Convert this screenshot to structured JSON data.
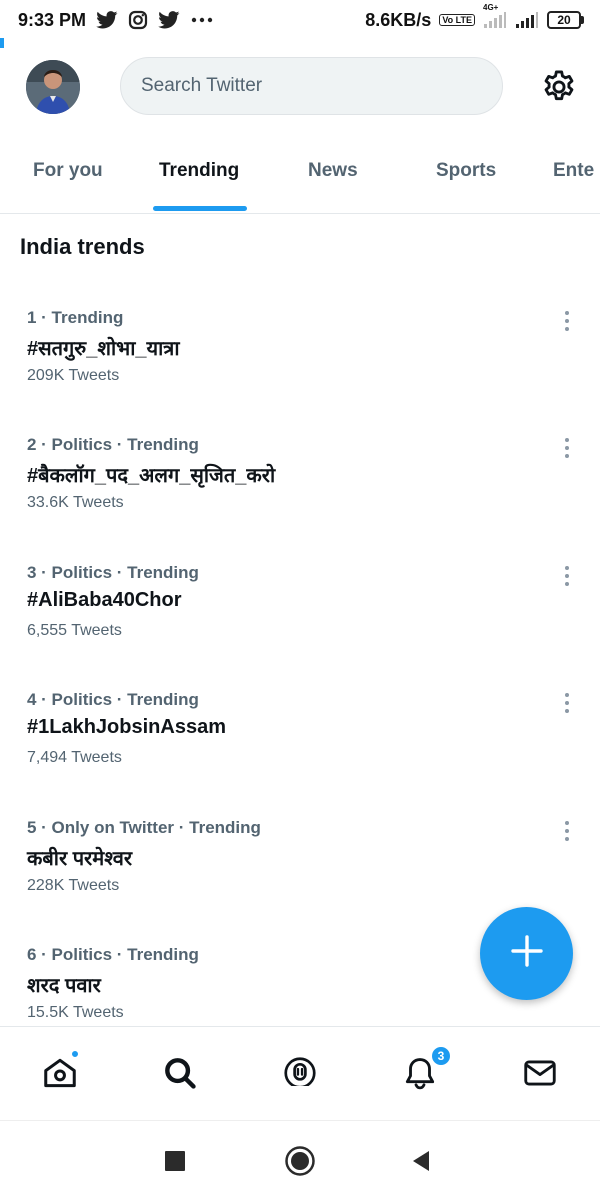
{
  "status_bar": {
    "time": "9:33 PM",
    "speed": "8.6KB/s",
    "volte": "Vo LTE",
    "network": "4G+",
    "battery": "20",
    "icons": [
      "twitter-bird-icon",
      "instagram-icon",
      "twitter-bird-icon",
      "more-dots-icon",
      "signal-icon",
      "battery-icon"
    ]
  },
  "header": {
    "search_placeholder": "Search Twitter",
    "settings_icon": "gear-icon"
  },
  "tabs": [
    {
      "label": "For you",
      "active": false
    },
    {
      "label": "Trending",
      "active": true
    },
    {
      "label": "News",
      "active": false
    },
    {
      "label": "Sports",
      "active": false
    },
    {
      "label": "Ente",
      "active": false
    }
  ],
  "section_title": "India trends",
  "trends": [
    {
      "meta": "1 · Trending",
      "name": "#सतगुरु_शोभा_यात्रा",
      "count": "209K Tweets"
    },
    {
      "meta": "2 · Politics · Trending",
      "name": "#बैकलॉग_पद_अलग_सृजित_करो",
      "count": "33.6K Tweets"
    },
    {
      "meta": "3 · Politics · Trending",
      "name": "#AliBaba40Chor",
      "count": "6,555 Tweets"
    },
    {
      "meta": "4 · Politics · Trending",
      "name": "#1LakhJobsinAssam",
      "count": "7,494 Tweets"
    },
    {
      "meta": "5 · Only on Twitter · Trending",
      "name": "कबीर परमेश्वर",
      "count": "228K Tweets"
    },
    {
      "meta": "6 · Politics · Trending",
      "name": "शरद पवार",
      "count": "15.5K Tweets"
    }
  ],
  "bottom_nav": {
    "items": [
      "home-icon",
      "search-icon",
      "spaces-icon",
      "notifications-icon",
      "messages-icon"
    ],
    "notifications_badge": "3"
  },
  "colors": {
    "accent": "#1d9bf0",
    "text_primary": "#0f1419",
    "text_secondary": "#536471"
  }
}
